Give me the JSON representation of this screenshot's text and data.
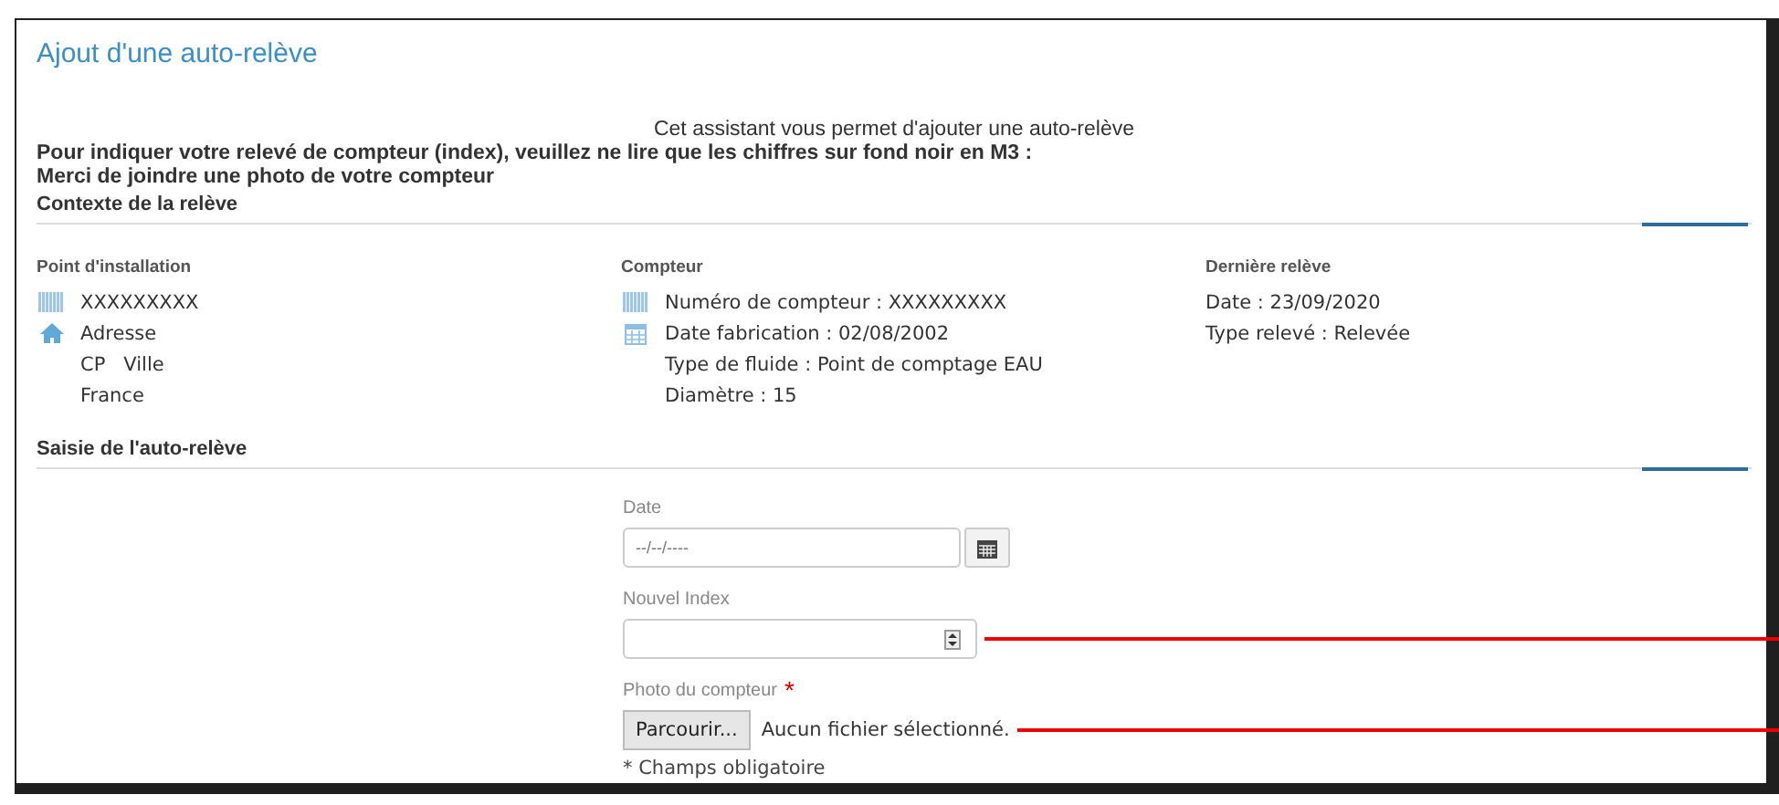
{
  "page_title": "Ajout d'une auto-relève",
  "intro": "Cet assistant vous permet d'ajouter une auto-relève",
  "instructions": [
    "Pour indiquer votre relevé de compteur (index), veuillez ne lire que les chiffres sur fond noir en M3 :",
    "Merci de joindre une photo de votre compteur"
  ],
  "context": {
    "heading": "Contexte de la relève",
    "columns": [
      {
        "title": "Point d'installation",
        "lines": [
          {
            "kind": "barcode",
            "text": "XXXXXXXXX"
          },
          {
            "kind": "home",
            "text": "Adresse"
          },
          {
            "kind": "plain",
            "text": "CP   Ville"
          },
          {
            "kind": "plain",
            "text": "France"
          }
        ]
      },
      {
        "title": "Compteur",
        "lines": [
          {
            "kind": "barcode",
            "text": "Numéro de compteur : XXXXXXXXX"
          },
          {
            "kind": "calendar",
            "text": "Date fabrication : 02/08/2002"
          },
          {
            "kind": "plain",
            "text": "Type de fluide : Point de comptage EAU"
          },
          {
            "kind": "plain",
            "text": "Diamètre : 15"
          }
        ]
      },
      {
        "title": "Dernière relève",
        "lines": [
          {
            "kind": "plain",
            "text": "Date : 23/09/2020"
          },
          {
            "kind": "plain",
            "text": "Type relevé : Relevée"
          }
        ]
      }
    ]
  },
  "entry": {
    "heading": "Saisie de l'auto-relève",
    "fields": [
      {
        "kind": "date",
        "label": "Date",
        "placeholder": "--/--/----",
        "annotated": false
      },
      {
        "kind": "number",
        "label": "Nouvel Index",
        "annotated": true
      },
      {
        "kind": "file",
        "label": "Photo du compteur",
        "required_mark": "*",
        "annotated": true,
        "button": "Parcourir...",
        "status": "Aucun fichier sélectionné."
      }
    ],
    "required_note": "* Champs obligatoire"
  }
}
